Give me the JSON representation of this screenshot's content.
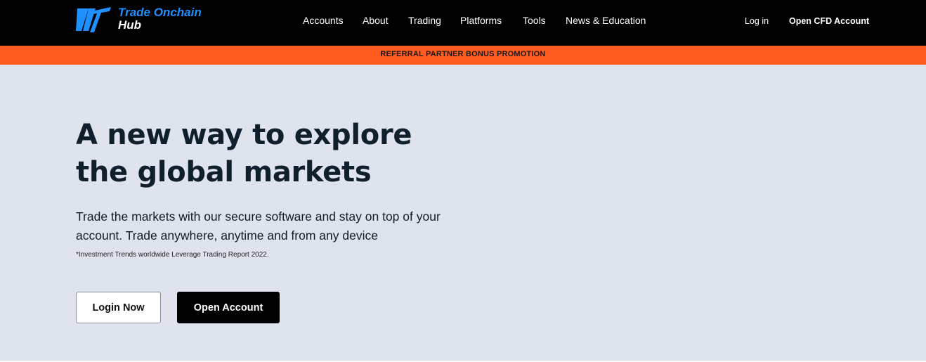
{
  "brand": {
    "name_line1": "Trade Onchain",
    "name_line2": "Hub",
    "logo_icon": "tw-logo-icon",
    "accent_color": "#1e90ff"
  },
  "nav": {
    "items": [
      {
        "label": "Accounts"
      },
      {
        "label": "About"
      },
      {
        "label": "Trading"
      },
      {
        "label": "Platforms"
      },
      {
        "label": "Tools"
      },
      {
        "label": "News & Education"
      }
    ],
    "login_label": "Log in",
    "open_cfd_label": "Open CFD Account"
  },
  "promo": {
    "text": "REFERRAL PARTNER BONUS PROMOTION",
    "color": "#ff5a1f"
  },
  "hero": {
    "title_line1": "A new way to explore",
    "title_line2": "the global markets",
    "subtitle_line1": "Trade the markets with our secure software and stay on top of your",
    "subtitle_line2": "account. Trade anywhere, anytime and from any device",
    "note": "*Investment Trends worldwide Leverage Trading Report 2022.",
    "login_button": "Login Now",
    "open_button": "Open Account"
  },
  "colors": {
    "background": "#dfe3ee",
    "header": "#000000",
    "title": "#0f1f2c"
  }
}
